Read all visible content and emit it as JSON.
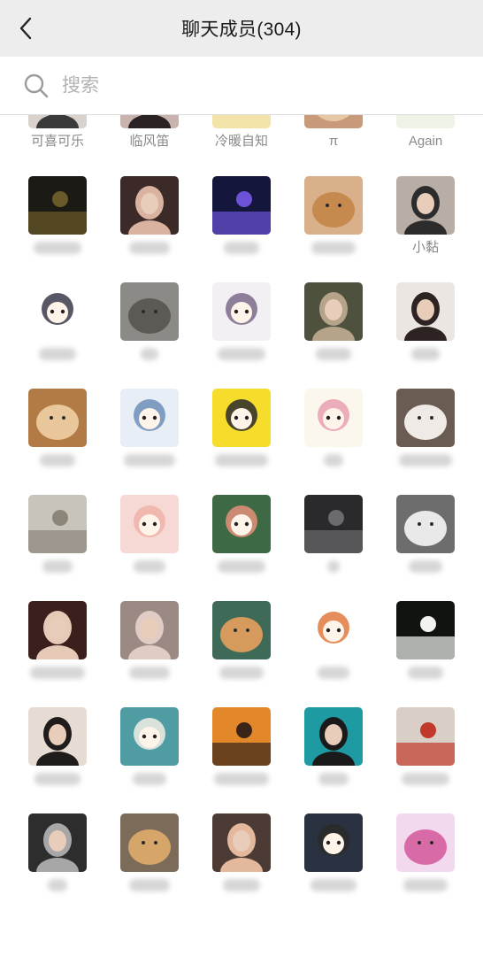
{
  "header": {
    "title": "聊天成员(304)",
    "back_icon": "chevron-left-icon"
  },
  "search": {
    "placeholder": "搜索",
    "icon": "search-icon"
  },
  "members": [
    {
      "name": "可喜可乐",
      "bg": "#d9d2cc",
      "fg": "#3a3a3a",
      "shape": "person"
    },
    {
      "name": "临风笛",
      "bg": "#c9b3ae",
      "fg": "#2b2323",
      "shape": "person"
    },
    {
      "name": "冷暖自知",
      "bg": "#f4e3a8",
      "fg": "#e6b43c",
      "shape": "cartoon"
    },
    {
      "name": "π",
      "bg": "#c89a7a",
      "fg": "#e8c7a6",
      "shape": "blob"
    },
    {
      "name": "Again",
      "bg": "#eef3e6",
      "fg": "#9fc36b",
      "shape": "cartoon"
    },
    {
      "name": "",
      "bg": "#1b1a14",
      "fg": "#6a5a2a",
      "shape": "night",
      "blur": 54
    },
    {
      "name": "",
      "bg": "#3b2a28",
      "fg": "#d9b39f",
      "shape": "person",
      "blur": 46
    },
    {
      "name": "",
      "bg": "#14163c",
      "fg": "#6b52d6",
      "shape": "night",
      "blur": 40
    },
    {
      "name": "",
      "bg": "#d9b08a",
      "fg": "#c68a4e",
      "shape": "blob",
      "blur": 50
    },
    {
      "name": "小黏",
      "bg": "#b9aea5",
      "fg": "#2c2c2c",
      "shape": "person"
    },
    {
      "name": "",
      "bg": "#ffffff",
      "fg": "#3a3a4a",
      "shape": "cartoon",
      "blur": 42
    },
    {
      "name": "",
      "bg": "#8c8a86",
      "fg": "#5d5a55",
      "shape": "blob",
      "blur": 20
    },
    {
      "name": "",
      "bg": "#f3f0f4",
      "fg": "#7a6b8a",
      "shape": "cartoon",
      "blur": 54
    },
    {
      "name": "",
      "bg": "#4f513f",
      "fg": "#b6a48a",
      "shape": "person",
      "blur": 40
    },
    {
      "name": "",
      "bg": "#ece6e2",
      "fg": "#2d2322",
      "shape": "person",
      "blur": 32
    },
    {
      "name": "",
      "bg": "#b27a45",
      "fg": "#e9c79b",
      "shape": "blob",
      "blur": 40
    },
    {
      "name": "",
      "bg": "#e8eef6",
      "fg": "#6c8fb8",
      "shape": "cartoon",
      "blur": 58
    },
    {
      "name": "",
      "bg": "#f6dd2c",
      "fg": "#2a2a2a",
      "shape": "cartoon",
      "blur": 60
    },
    {
      "name": "",
      "bg": "#fbf7ec",
      "fg": "#e8a0b0",
      "shape": "cartoon",
      "blur": 22
    },
    {
      "name": "",
      "bg": "#6a5c52",
      "fg": "#efeae5",
      "shape": "blob",
      "blur": 60
    },
    {
      "name": "",
      "bg": "#c9c4bb",
      "fg": "#8b857a",
      "shape": "night",
      "blur": 34
    },
    {
      "name": "",
      "bg": "#f6d8d4",
      "fg": "#f0b3a9",
      "shape": "cartoon",
      "blur": 36
    },
    {
      "name": "",
      "bg": "#3d6a45",
      "fg": "#e68f7a",
      "shape": "cartoon",
      "blur": 54
    },
    {
      "name": "",
      "bg": "#2a2a2c",
      "fg": "#6b6b6e",
      "shape": "night",
      "blur": 14
    },
    {
      "name": "",
      "bg": "#6d6d6d",
      "fg": "#e9e9e9",
      "shape": "blob",
      "blur": 38
    },
    {
      "name": "",
      "bg": "#3b1f1c",
      "fg": "#e7c9b8",
      "shape": "person",
      "blur": 62
    },
    {
      "name": "",
      "bg": "#9b8a84",
      "fg": "#e0ccc5",
      "shape": "person",
      "blur": 46
    },
    {
      "name": "",
      "bg": "#3f6a58",
      "fg": "#d69a5c",
      "shape": "blob",
      "blur": 50
    },
    {
      "name": "",
      "bg": "#ffffff",
      "fg": "#e07a40",
      "shape": "cartoon",
      "blur": 36
    },
    {
      "name": "",
      "bg": "#101410",
      "fg": "#f2f2ef",
      "shape": "night",
      "blur": 40
    },
    {
      "name": "",
      "bg": "#e6dcd4",
      "fg": "#201c1c",
      "shape": "person",
      "blur": 52
    },
    {
      "name": "",
      "bg": "#4f9da3",
      "fg": "#f2efe6",
      "shape": "cartoon",
      "blur": 38
    },
    {
      "name": "",
      "bg": "#e2882a",
      "fg": "#3a2418",
      "shape": "night",
      "blur": 62
    },
    {
      "name": "",
      "bg": "#1e9aa3",
      "fg": "#1a1a1a",
      "shape": "person",
      "blur": 34
    },
    {
      "name": "",
      "bg": "#d9cfc6",
      "fg": "#c0392b",
      "shape": "night",
      "blur": 54
    },
    {
      "name": "",
      "bg": "#2d2d2d",
      "fg": "#a7a7a7",
      "shape": "person",
      "blur": 22
    },
    {
      "name": "",
      "bg": "#7c6b58",
      "fg": "#d6a56a",
      "shape": "blob",
      "blur": 46
    },
    {
      "name": "",
      "bg": "#4b3b34",
      "fg": "#e4b89c",
      "shape": "person",
      "blur": 42
    },
    {
      "name": "",
      "bg": "#2a3140",
      "fg": "#2a2a2a",
      "shape": "cartoon",
      "blur": 52
    },
    {
      "name": "",
      "bg": "#f3d9ee",
      "fg": "#d96aa8",
      "shape": "blob",
      "blur": 50
    }
  ]
}
